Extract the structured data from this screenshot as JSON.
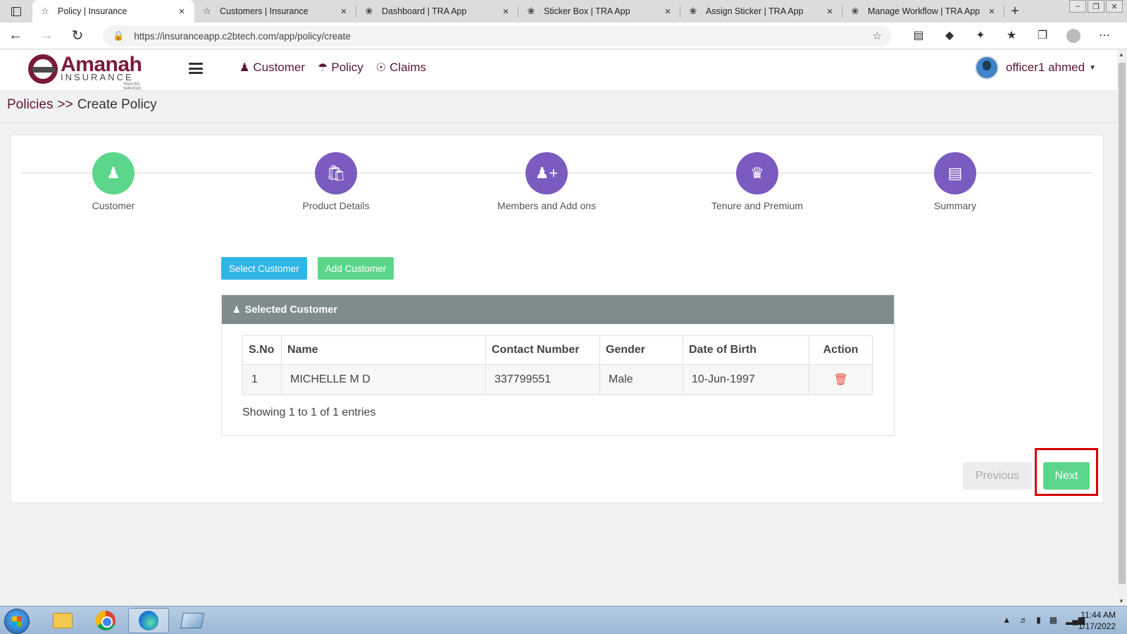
{
  "browser": {
    "tabs": [
      {
        "title": "Policy | Insurance",
        "icon": "shield-icon",
        "active": true
      },
      {
        "title": "Customers | Insurance",
        "icon": "shield-icon",
        "active": false
      },
      {
        "title": "Dashboard | TRA App",
        "icon": "emblem-icon",
        "active": false
      },
      {
        "title": "Sticker Box | TRA App",
        "icon": "emblem-icon",
        "active": false
      },
      {
        "title": "Assign Sticker | TRA App",
        "icon": "emblem-icon",
        "active": false
      },
      {
        "title": "Manage Workflow | TRA App",
        "icon": "emblem-icon",
        "active": false
      }
    ],
    "close_glyph": "×",
    "new_tab_glyph": "+",
    "url": "https://insuranceapp.c2btech.com/app/policy/create"
  },
  "app": {
    "logo": {
      "brand": "Amanah",
      "sub": "INSURANCE",
      "tagline": "TRUSTED SERVICES"
    },
    "nav": [
      {
        "label": "Customer",
        "icon": "user-icon"
      },
      {
        "label": "Policy",
        "icon": "umbrella-icon"
      },
      {
        "label": "Claims",
        "icon": "shield-outline-icon"
      }
    ],
    "user": {
      "name": "officer1 ahmed"
    }
  },
  "breadcrumb": {
    "root": "Policies",
    "separator": ">>",
    "current": "Create Policy"
  },
  "stepper": {
    "steps": [
      {
        "label": "Customer",
        "icon": "user-icon",
        "state": "done"
      },
      {
        "label": "Product Details",
        "icon": "shopping-bag-icon",
        "state": "todo"
      },
      {
        "label": "Members and Add ons",
        "icon": "user-plus-icon",
        "state": "todo"
      },
      {
        "label": "Tenure and Premium",
        "icon": "crown-icon",
        "state": "todo"
      },
      {
        "label": "Summary",
        "icon": "document-icon",
        "state": "todo"
      }
    ]
  },
  "actions": {
    "select_customer": "Select Customer",
    "add_customer": "Add Customer"
  },
  "selected_customer": {
    "heading": "Selected Customer",
    "columns": [
      "S.No",
      "Name",
      "Contact Number",
      "Gender",
      "Date of Birth",
      "Action"
    ],
    "rows": [
      {
        "sno": "1",
        "name": "MICHELLE M D",
        "contact": "337799551",
        "gender": "Male",
        "dob": "10-Jun-1997"
      }
    ],
    "showing": "Showing 1 to 1 of 1 entries"
  },
  "footer_buttons": {
    "previous": "Previous",
    "next": "Next"
  },
  "colors": {
    "brand": "#7a1b3a",
    "step_done": "#5cd68a",
    "step_todo": "#7b5bbf",
    "info": "#2fb5e6",
    "success": "#5cd68a",
    "panel_head": "#7f8c8d",
    "danger": "#e74c3c",
    "highlight": "#d90000"
  },
  "taskbar": {
    "time": "11:44 AM",
    "date": "1/17/2022"
  }
}
